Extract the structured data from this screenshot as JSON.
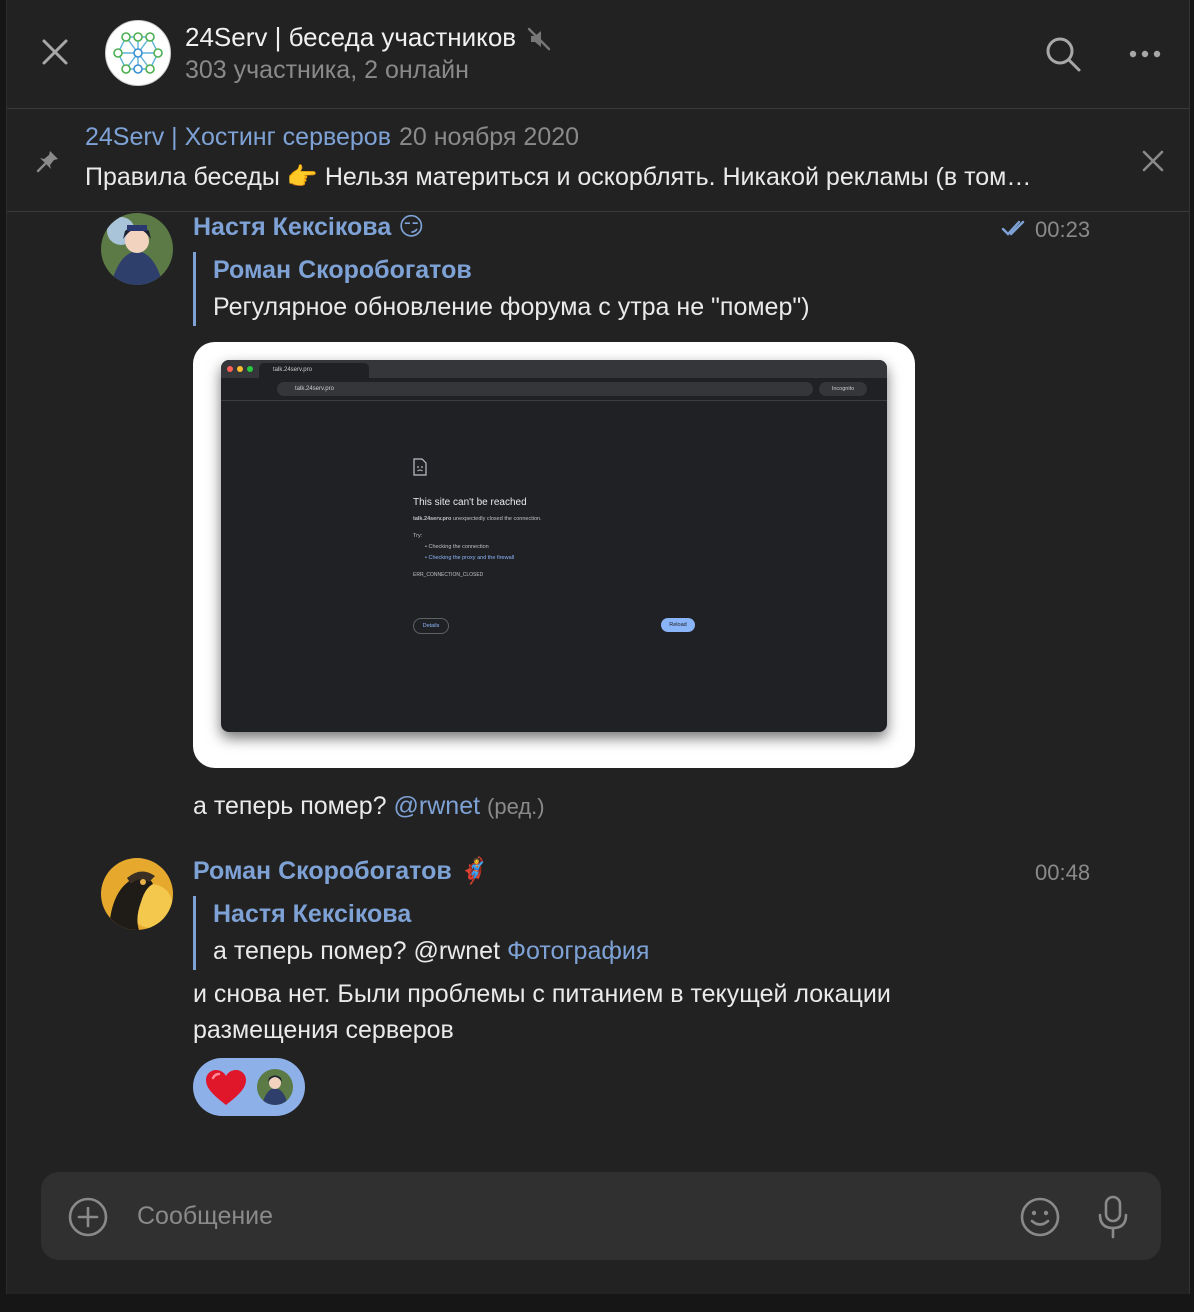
{
  "header": {
    "title": "24Serv | беседа участников",
    "subtitle": "303 участника, 2 онлайн"
  },
  "pinned": {
    "title": "24Serv | Хостинг серверов",
    "date": "20 ноября 2020",
    "text": "Правила беседы 👉 Нельзя материться и оскорблять. Никакой рекламы (в том…"
  },
  "messages": [
    {
      "author": "Настя Кексікова",
      "author_emoji": "😏",
      "time": "00:23",
      "reply_author": "Роман Скоробогатов",
      "reply_text": "Регулярное обновление форума с утра не \"помер\")",
      "text": "а теперь помер?",
      "mention": "@rwnet",
      "edited": "(ред.)",
      "photo": {
        "tab": "talk.24serv.pro",
        "url": "talk.24serv.pro",
        "incognito": "Incognito",
        "heading": "This site can't be reached",
        "domain": "talk.24serv.pro",
        "detail": " unexpectedly closed the connection.",
        "try": "Try:",
        "tip1": "Checking the connection",
        "tip2": "Checking the proxy and the firewall",
        "error": "ERR_CONNECTION_CLOSED",
        "details_btn": "Details",
        "reload_btn": "Reload"
      }
    },
    {
      "author": "Роман Скоробогатов",
      "author_emoji": "🦸",
      "time": "00:48",
      "reply_author": "Настя Кексікова",
      "reply_text": "а теперь помер? @rwnet",
      "reply_attachment": "Фотография",
      "text_line1": "и снова нет. Были проблемы с питанием в текущей локации",
      "text_line2": "размещения серверов",
      "reaction_emoji": "❤️"
    }
  ],
  "composer": {
    "placeholder": "Сообщение"
  }
}
